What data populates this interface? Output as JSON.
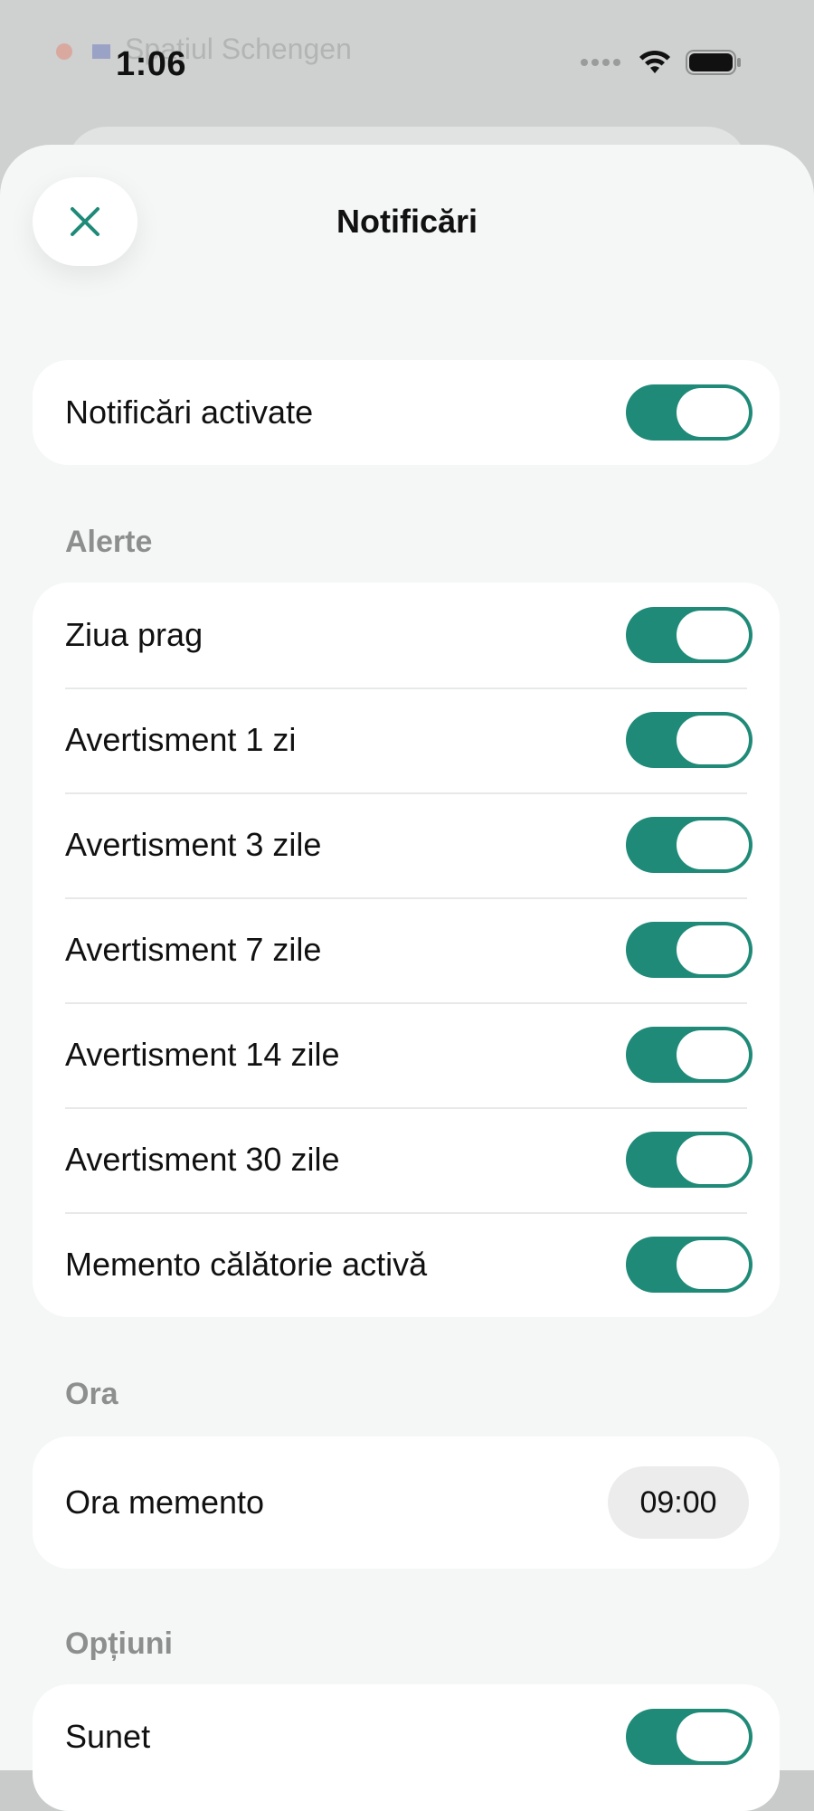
{
  "status_bar": {
    "time": "1:06"
  },
  "background_app": {
    "row_label": "Spațiul Schengen"
  },
  "sheet": {
    "title": "Notificări"
  },
  "master": {
    "label": "Notificări activate",
    "enabled": true
  },
  "sections": {
    "alerts": {
      "label": "Alerte",
      "items": [
        {
          "label": "Ziua prag",
          "enabled": true
        },
        {
          "label": "Avertisment 1 zi",
          "enabled": true
        },
        {
          "label": "Avertisment 3 zile",
          "enabled": true
        },
        {
          "label": "Avertisment 7 zile",
          "enabled": true
        },
        {
          "label": "Avertisment 14 zile",
          "enabled": true
        },
        {
          "label": "Avertisment 30 zile",
          "enabled": true
        },
        {
          "label": "Memento călătorie activă",
          "enabled": true
        }
      ]
    },
    "time": {
      "label": "Ora",
      "reminder_label": "Ora memento",
      "reminder_value": "09:00"
    },
    "options": {
      "label": "Opțiuni",
      "items": [
        {
          "label": "Sunet",
          "enabled": true
        }
      ]
    }
  },
  "colors": {
    "accent": "#1f8a78",
    "section_label": "#8d8f8e",
    "sheet_bg": "#f5f7f6"
  }
}
